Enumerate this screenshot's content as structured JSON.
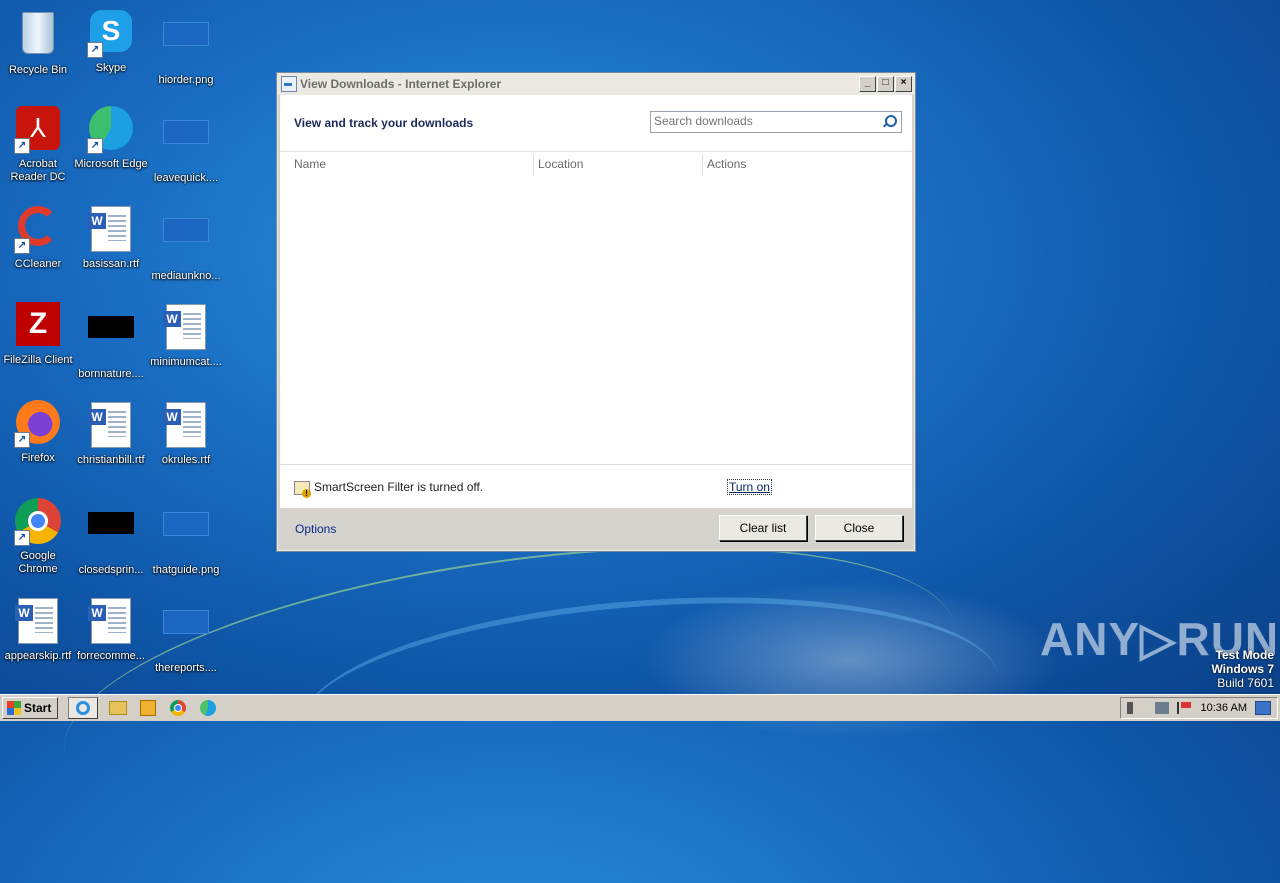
{
  "desktop": {
    "icons": [
      {
        "label": "Recycle Bin",
        "icon": "recycle-bin-icon"
      },
      {
        "label": "Skype",
        "icon": "skype-icon"
      },
      {
        "label": "hiorder.png",
        "icon": "image-file-icon"
      },
      {
        "label": "Acrobat Reader DC",
        "icon": "acrobat-icon"
      },
      {
        "label": "Microsoft Edge",
        "icon": "edge-icon"
      },
      {
        "label": "leavequick....",
        "icon": "image-file-icon"
      },
      {
        "label": "CCleaner",
        "icon": "ccleaner-icon"
      },
      {
        "label": "basissan.rtf",
        "icon": "word-document-icon"
      },
      {
        "label": "mediaunkno...",
        "icon": "image-file-icon"
      },
      {
        "label": "FileZilla Client",
        "icon": "filezilla-icon"
      },
      {
        "label": "bornnature....",
        "icon": "black-image-file-icon"
      },
      {
        "label": "minimumcat....",
        "icon": "word-document-icon"
      },
      {
        "label": "Firefox",
        "icon": "firefox-icon"
      },
      {
        "label": "christianbill.rtf",
        "icon": "word-document-icon"
      },
      {
        "label": "okrules.rtf",
        "icon": "word-document-icon"
      },
      {
        "label": "Google Chrome",
        "icon": "chrome-icon"
      },
      {
        "label": "closedsprin...",
        "icon": "black-image-file-icon"
      },
      {
        "label": "thatguide.png",
        "icon": "image-file-icon"
      },
      {
        "label": "appearskip.rtf",
        "icon": "word-document-icon"
      },
      {
        "label": "forrecomme...",
        "icon": "word-document-icon"
      },
      {
        "label": "thereports....",
        "icon": "image-file-icon"
      }
    ]
  },
  "window": {
    "title": "View Downloads - Internet Explorer",
    "controls": {
      "minimize": "_",
      "maximize": "□",
      "close": "×"
    },
    "header_title": "View and track your downloads",
    "search_placeholder": "Search downloads",
    "columns": {
      "name": "Name",
      "location": "Location",
      "actions": "Actions"
    },
    "smartscreen": {
      "message": "SmartScreen Filter is turned off.",
      "link": "Turn on"
    },
    "footer": {
      "options": "Options",
      "clear_list": "Clear list",
      "close": "Close"
    }
  },
  "watermark": {
    "brand": "ANY▷RUN",
    "test_mode": "Test Mode",
    "os": "Windows 7",
    "build": "Build 7601"
  },
  "taskbar": {
    "start_label": "Start",
    "clock": "10:36 AM"
  }
}
